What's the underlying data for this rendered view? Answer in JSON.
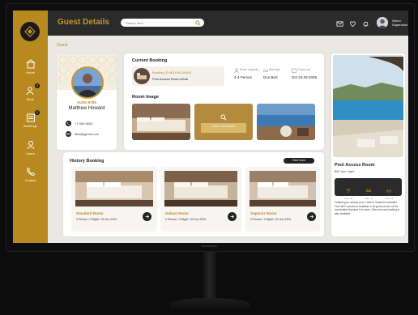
{
  "app": {
    "title": "Guest Details",
    "breadcrumb": "Guest"
  },
  "sidebar": {
    "items": [
      {
        "label": "Home",
        "icon": "home-icon"
      },
      {
        "label": "Book",
        "icon": "book-icon",
        "badge": "2"
      },
      {
        "label": "Bookings",
        "icon": "bookings-icon",
        "badge": "2"
      },
      {
        "label": "Users",
        "icon": "user-icon"
      },
      {
        "label": "Contact",
        "icon": "contact-icon"
      }
    ]
  },
  "topbar": {
    "search_placeholder": "Search here",
    "user_name": "Glenn",
    "user_role": "Supervisor"
  },
  "guest": {
    "id": "#USG-6789",
    "name": "Matthew Howard",
    "phone": "+1 556 5654",
    "email": "Matt@gmail.com"
  },
  "current_booking": {
    "title": "Current Booking",
    "booking_id": "Booking ID #BOOK100589",
    "room": "Pool Access Room A2a6",
    "fields": [
      {
        "label": "Room capacity",
        "value": "3-4 Person"
      },
      {
        "label": "Bed type",
        "value": "Duo Bed"
      },
      {
        "label": "Check out",
        "value": "Oct 24-29 2025"
      }
    ]
  },
  "room_image": {
    "title": "Room Image",
    "overlay": "View Full screen"
  },
  "history": {
    "title": "History Booking",
    "button": "View more",
    "items": [
      {
        "name": "Standard Room",
        "detail": "3 Person / 3 Night / 33 Jun 2024"
      },
      {
        "name": "Deluxe Room",
        "detail": "2 Person / 3 Night / 33 Jun 2024"
      },
      {
        "name": "Superior Room",
        "detail": "2 Person / 2 Night / 33 Jun 2024"
      }
    ]
  },
  "promo": {
    "name": "Pool Access Room",
    "price": "$50 /per night",
    "amenities": [
      "View all",
      "View all",
      "View all"
    ],
    "description": "Featuring an outdoor pool, Hotel in Seabell is beautiful. Free Wi-Fi access is available in all guest rooms. All the comfortable furniture is in room. Extra bed and parking is also available."
  },
  "colors": {
    "accent": "#b8891f",
    "topbar": "#2b2b2b",
    "bg": "#e9e8e4"
  }
}
